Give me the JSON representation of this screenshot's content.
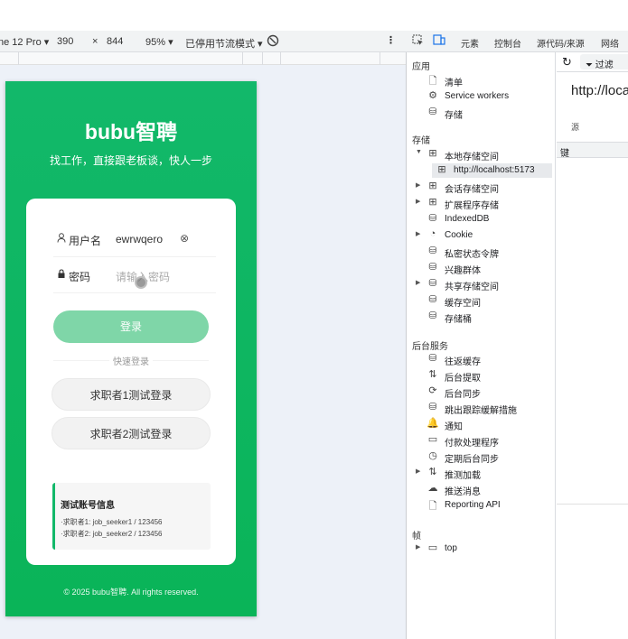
{
  "devtoolbar": {
    "device": "ne 12 Pro ▾",
    "width": "390",
    "x": "×",
    "height": "844",
    "zoom": "95% ▾",
    "throttle": "已停用节流模式 ▾",
    "rotate_icon": "rotate-icon",
    "more_icon": "more-vert-icon"
  },
  "app": {
    "brand": "bubu智聘",
    "slogan": "找工作，直接跟老板谈，快人一步",
    "username": {
      "icon": "user-icon",
      "label": "用户名",
      "value": "ewrwqero",
      "clear_icon": "clear-icon"
    },
    "password": {
      "icon": "lock-icon",
      "label": "密码",
      "placeholder": "请输入密码"
    },
    "login": "登录",
    "quick": "快速登录",
    "quick1": "求职者1测试登录",
    "quick2": "求职者2测试登录",
    "info": {
      "title": "测试账号信息",
      "line1": "·求职者1: job_seeker1 / 123456",
      "line2": "·求职者2: job_seeker2 / 123456"
    },
    "copyright": "© 2025 bubu智聘. All rights reserved."
  },
  "devtools": {
    "tabs": [
      "元素",
      "控制台",
      "源代码/来源",
      "网络"
    ],
    "refresh_icon": "refresh-icon",
    "filter": "过滤",
    "sections": {
      "app": "应用",
      "storage": "存储",
      "bg": "后台服务",
      "frames": "帧"
    },
    "app_items": [
      "清单",
      "Service workers",
      "存储"
    ],
    "storage_items": [
      "本地存储空间",
      "http://localhost:5173",
      "会话存储空间",
      "扩展程序存储",
      "IndexedDB",
      "Cookie",
      "私密状态令牌",
      "兴趣群体",
      "共享存储空间",
      "缓存空间",
      "存储桶"
    ],
    "bg_items": [
      "往返缓存",
      "后台提取",
      "后台同步",
      "跳出跟踪缓解措施",
      "通知",
      "付款处理程序",
      "定期后台同步",
      "推测加载",
      "推送消息",
      "Reporting API"
    ],
    "frame_items": [
      "top"
    ],
    "url": "http://loca",
    "source": "源",
    "key": "键"
  },
  "colors": {
    "brand_green": "#12b86a",
    "login_disabled": "#7fd6a8"
  }
}
